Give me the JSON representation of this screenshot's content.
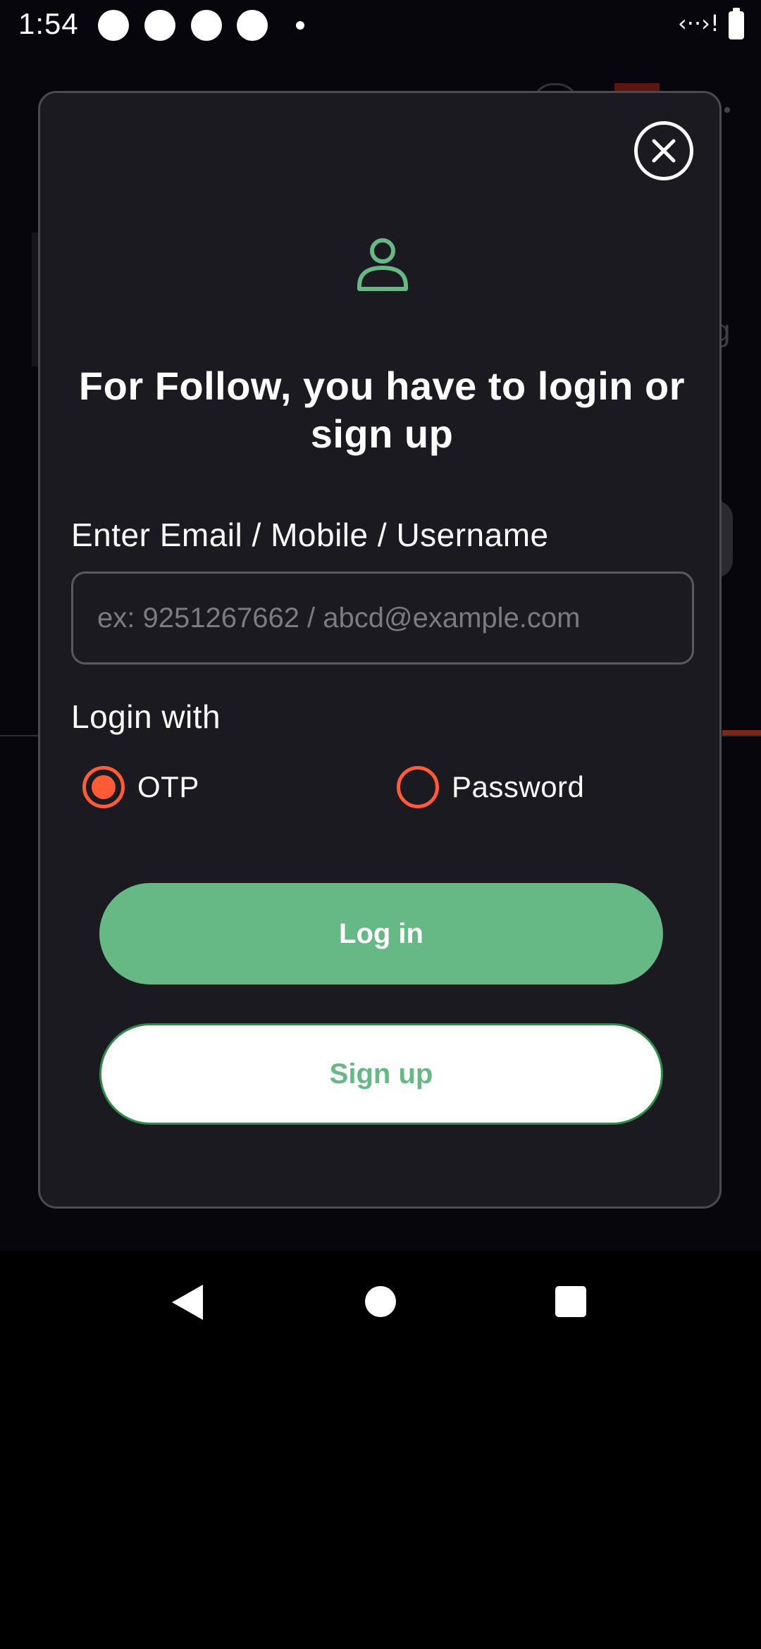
{
  "status_bar": {
    "time": "1:54",
    "network_icon": "wifi-data-icon",
    "network_glyph": "‹··›!",
    "battery_icon": "battery-icon"
  },
  "modal": {
    "close_icon": "close-icon",
    "user_icon": "user-icon",
    "title": "For Follow, you have to login or sign up",
    "field_label": "Enter Email / Mobile / Username",
    "input": {
      "value": "",
      "placeholder": "ex: 9251267662 / abcd@example.com"
    },
    "login_with_label": "Login with",
    "options": [
      {
        "label": "OTP",
        "selected": true
      },
      {
        "label": "Password",
        "selected": false
      }
    ],
    "login_button": "Log in",
    "signup_button": "Sign up"
  },
  "colors": {
    "accent_green": "#66b985",
    "radio_orange": "#ff5c35",
    "modal_bg": "#1b1a20"
  },
  "nav_bar": {
    "back_icon": "back-triangle-icon",
    "home_icon": "home-circle-icon",
    "recents_icon": "recents-square-icon"
  }
}
